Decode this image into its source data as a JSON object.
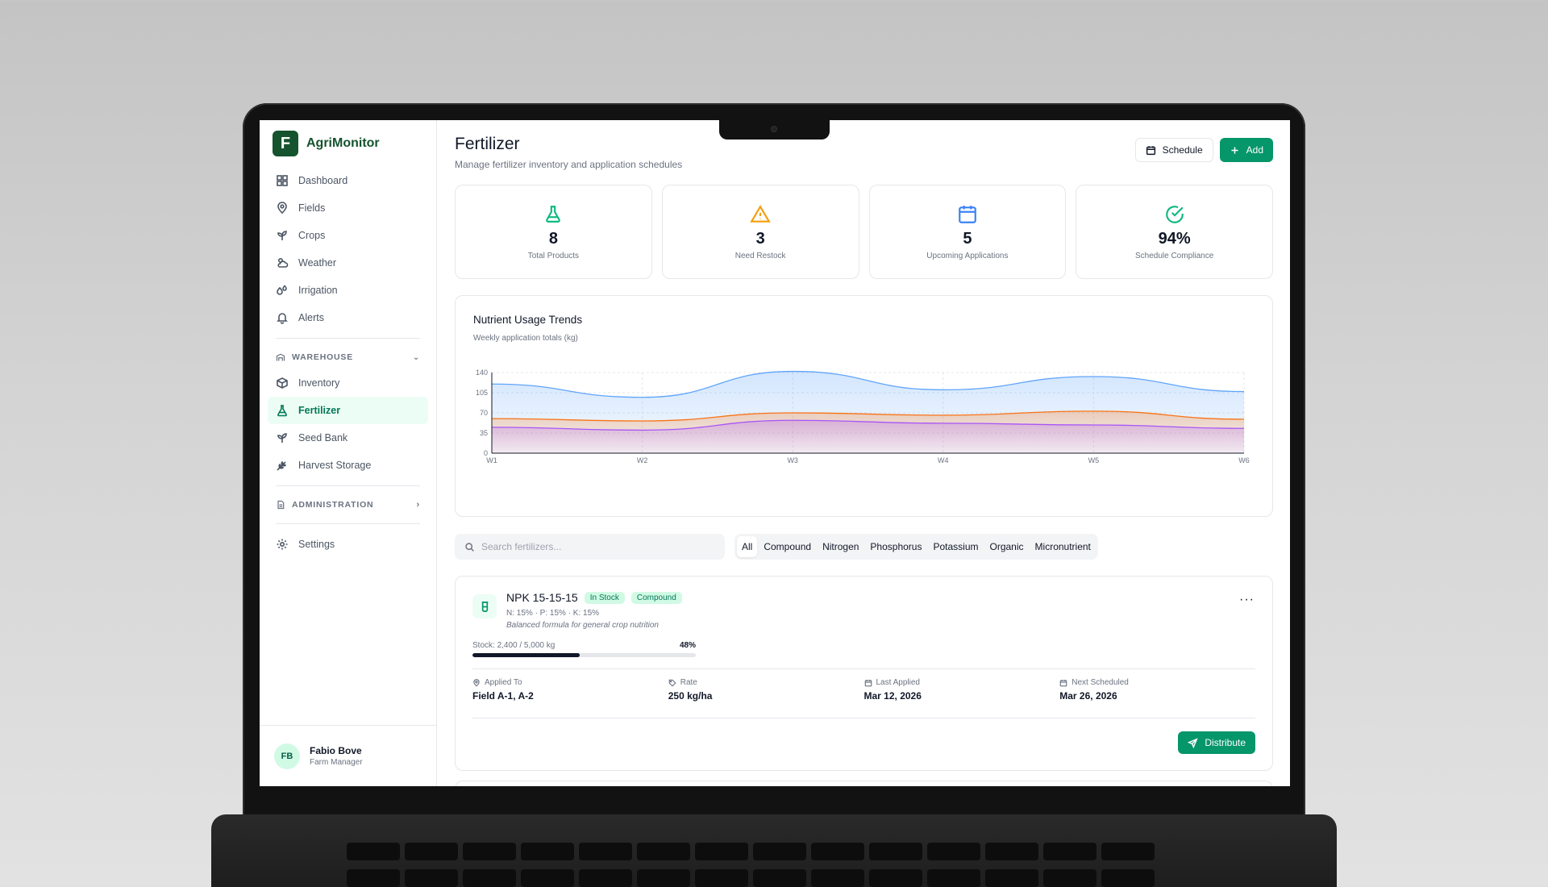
{
  "app": {
    "name": "AgriMonitor",
    "logo_letter": "F"
  },
  "sidebar": {
    "items": [
      {
        "label": "Dashboard",
        "icon": "dashboard-icon"
      },
      {
        "label": "Fields",
        "icon": "map-pin-icon"
      },
      {
        "label": "Crops",
        "icon": "sprout-icon"
      },
      {
        "label": "Weather",
        "icon": "cloud-sun-icon"
      },
      {
        "label": "Irrigation",
        "icon": "droplets-icon"
      },
      {
        "label": "Alerts",
        "icon": "bell-icon"
      }
    ],
    "warehouse": {
      "title": "WAREHOUSE",
      "items": [
        {
          "label": "Inventory",
          "icon": "box-icon"
        },
        {
          "label": "Fertilizer",
          "icon": "flask-icon",
          "active": true
        },
        {
          "label": "Seed Bank",
          "icon": "sprout-icon"
        },
        {
          "label": "Harvest Storage",
          "icon": "wheat-icon"
        }
      ]
    },
    "administration": {
      "title": "ADMINISTRATION"
    },
    "settings": {
      "label": "Settings"
    }
  },
  "user": {
    "initials": "FB",
    "name": "Fabio Bove",
    "role": "Farm Manager"
  },
  "header": {
    "title": "Fertilizer",
    "subtitle": "Manage fertilizer inventory and application schedules",
    "schedule_label": "Schedule",
    "add_label": "Add"
  },
  "stats": [
    {
      "value": "8",
      "label": "Total Products",
      "icon": "flask-icon",
      "color": "#10b981"
    },
    {
      "value": "3",
      "label": "Need Restock",
      "icon": "alert-triangle-icon",
      "color": "#f59e0b"
    },
    {
      "value": "5",
      "label": "Upcoming Applications",
      "icon": "calendar-icon",
      "color": "#3b82f6"
    },
    {
      "value": "94%",
      "label": "Schedule Compliance",
      "icon": "check-circle-icon",
      "color": "#10b981"
    }
  ],
  "chart": {
    "title": "Nutrient Usage Trends",
    "subtitle": "Weekly application totals (kg)"
  },
  "chart_data": {
    "type": "area",
    "title": "Nutrient Usage Trends",
    "subtitle": "Weekly application totals (kg)",
    "categories": [
      "W1",
      "W2",
      "W3",
      "W4",
      "W5",
      "W6"
    ],
    "yticks": [
      "0",
      "35",
      "70",
      "105",
      "140"
    ],
    "ylim": [
      0,
      140
    ],
    "series": [
      {
        "values": [
          120,
          97,
          142,
          110,
          133,
          107
        ],
        "color": "#60a5fa"
      },
      {
        "values": [
          60,
          56,
          70,
          66,
          73,
          59
        ],
        "color": "#f97316"
      },
      {
        "values": [
          45,
          40,
          57,
          52,
          49,
          43
        ],
        "color": "#a855f7"
      }
    ]
  },
  "search": {
    "placeholder": "Search fertilizers..."
  },
  "filters": [
    "All",
    "Compound",
    "Nitrogen",
    "Phosphorus",
    "Potassium",
    "Organic",
    "Micronutrient"
  ],
  "product": {
    "name": "NPK 15-15-15",
    "status_badge": "In Stock",
    "type_badge": "Compound",
    "npk": "N: 15% · P: 15% · K: 15%",
    "description": "Balanced formula for general crop nutrition",
    "stock_text": "Stock: 2,400 / 5,000 kg",
    "stock_pct_label": "48%",
    "stock_fraction": 0.48,
    "applied_to_label": "Applied To",
    "applied_to": "Field A-1, A-2",
    "rate_label": "Rate",
    "rate": "250 kg/ha",
    "last_applied_label": "Last Applied",
    "last_applied": "Mar 12, 2026",
    "next_scheduled_label": "Next Scheduled",
    "next_scheduled": "Mar 26, 2026",
    "distribute_label": "Distribute"
  }
}
